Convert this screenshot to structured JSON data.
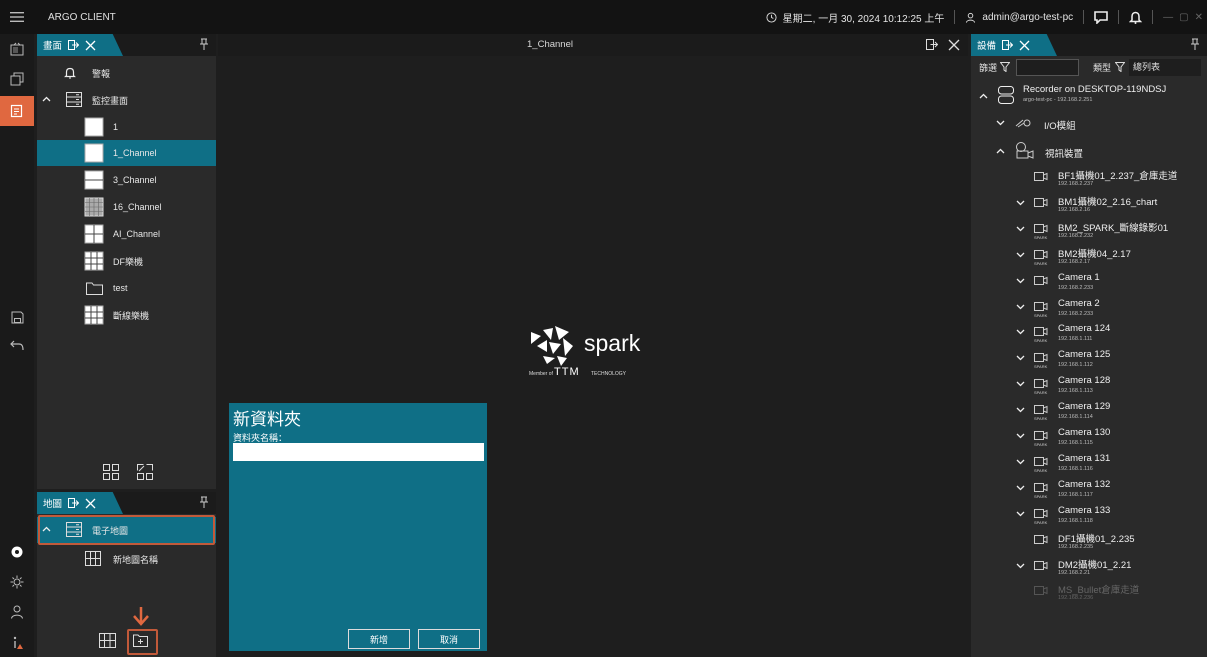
{
  "titlebar": {
    "app_title": "ARGO CLIENT",
    "datetime": "星期二, 一月 30, 2024 10:12:25 上午",
    "user": "admin@argo-test-pc",
    "window_controls": [
      "—",
      "▢",
      "✕"
    ]
  },
  "screen_panel": {
    "tab_label": "畫面",
    "alarm_label": "警報",
    "group_label": "監控畫面",
    "items": [
      {
        "label": "1",
        "icon": "layout-1-icon"
      },
      {
        "label": "1_Channel",
        "icon": "layout-1-icon",
        "selected": true
      },
      {
        "label": "3_Channel",
        "icon": "layout-3-icon"
      },
      {
        "label": "16_Channel",
        "icon": "layout-16-icon"
      },
      {
        "label": "AI_Channel",
        "icon": "layout-4-icon"
      },
      {
        "label": "DF樂機",
        "icon": "layout-9-icon"
      },
      {
        "label": "test",
        "icon": "folder-icon"
      },
      {
        "label": "斷線樂機",
        "icon": "layout-9-icon"
      }
    ]
  },
  "map_panel": {
    "tab_label": "地圖",
    "group_label": "電子地圖",
    "items": [
      {
        "label": "新地圖名稱"
      }
    ]
  },
  "center": {
    "title": "1_Channel",
    "logo_text": "spark",
    "logo_sub_prefix": "Member of",
    "logo_sub_brand": "TTM",
    "logo_sub_suffix": "TECHNOLOGY"
  },
  "dialog": {
    "title": "新資料夾",
    "field_label": "資料夾名稱：",
    "field_value": "",
    "ok_label": "新增",
    "cancel_label": "取消"
  },
  "device_panel": {
    "tab_label": "設備",
    "filter_label": "篩選",
    "type_label": "類型",
    "type_value": "總列表",
    "recorder_name": "Recorder on DESKTOP-119NDSJ",
    "recorder_sub": "argo-test-pc - 192.168.2.251",
    "io_label": "I/O模組",
    "video_label": "視訊裝置",
    "devices": [
      {
        "name": "BF1攝機01_2.237_倉庫走道",
        "ip": "192.168.2.237",
        "expandable": false,
        "spark": false,
        "disabled": false
      },
      {
        "name": "BM1攝機02_2.16_chart",
        "ip": "192.168.2.16",
        "expandable": true,
        "spark": false,
        "disabled": false
      },
      {
        "name": "BM2_SPARK_斷線錄影01",
        "ip": "192.168.2.232",
        "expandable": true,
        "spark": true,
        "disabled": false
      },
      {
        "name": "BM2攝機04_2.17",
        "ip": "192.168.2.17",
        "expandable": true,
        "spark": true,
        "disabled": false
      },
      {
        "name": "Camera 1",
        "ip": "192.168.2.233",
        "expandable": true,
        "spark": false,
        "disabled": false
      },
      {
        "name": "Camera 2",
        "ip": "192.168.2.233",
        "expandable": true,
        "spark": true,
        "disabled": false
      },
      {
        "name": "Camera 124",
        "ip": "192.168.1.111",
        "expandable": true,
        "spark": true,
        "disabled": false
      },
      {
        "name": "Camera 125",
        "ip": "192.168.1.112",
        "expandable": true,
        "spark": true,
        "disabled": false
      },
      {
        "name": "Camera 128",
        "ip": "192.168.1.113",
        "expandable": true,
        "spark": true,
        "disabled": false
      },
      {
        "name": "Camera 129",
        "ip": "192.168.1.114",
        "expandable": true,
        "spark": true,
        "disabled": false
      },
      {
        "name": "Camera 130",
        "ip": "192.168.1.115",
        "expandable": true,
        "spark": true,
        "disabled": false
      },
      {
        "name": "Camera 131",
        "ip": "192.168.1.116",
        "expandable": true,
        "spark": true,
        "disabled": false
      },
      {
        "name": "Camera 132",
        "ip": "192.168.1.117",
        "expandable": true,
        "spark": true,
        "disabled": false
      },
      {
        "name": "Camera 133",
        "ip": "192.168.1.118",
        "expandable": true,
        "spark": true,
        "disabled": false
      },
      {
        "name": "DF1攝機01_2.235",
        "ip": "192.168.2.235",
        "expandable": false,
        "spark": false,
        "disabled": false
      },
      {
        "name": "DM2攝機01_2.21",
        "ip": "192.168.2.21",
        "expandable": true,
        "spark": false,
        "disabled": false
      },
      {
        "name": "MS_Bullet倉庫走道",
        "ip": "192.168.2.236",
        "expandable": false,
        "spark": false,
        "disabled": true
      }
    ]
  },
  "colors": {
    "accent": "#0f6f86",
    "highlight": "#e06840",
    "bg": "#1e1e1e",
    "panel": "#2a2a2a"
  }
}
